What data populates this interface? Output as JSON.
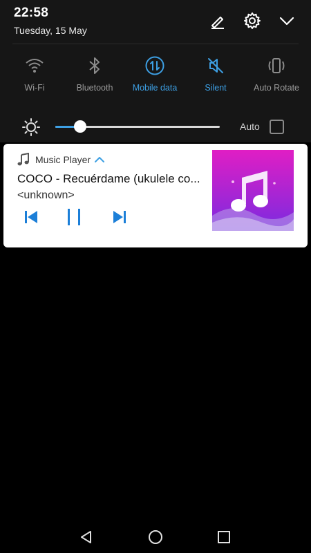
{
  "status": {
    "time": "22:58",
    "date": "Tuesday, 15 May"
  },
  "header_actions": {
    "edit_icon": "pencil-edit-icon",
    "settings_icon": "gear-icon",
    "collapse_icon": "chevron-down-icon"
  },
  "quick_toggles": [
    {
      "label": "Wi-Fi",
      "icon": "wifi-icon",
      "active": false
    },
    {
      "label": "Bluetooth",
      "icon": "bluetooth-icon",
      "active": false
    },
    {
      "label": "Mobile data",
      "icon": "mobile-data-icon",
      "active": true
    },
    {
      "label": "Silent",
      "icon": "silent-icon",
      "active": true
    },
    {
      "label": "Auto Rotate",
      "icon": "auto-rotate-icon",
      "active": false
    }
  ],
  "brightness": {
    "level": 0.15,
    "auto_label": "Auto",
    "auto_checked": false
  },
  "music": {
    "app_name": "Music Player",
    "title": "COCO - Recuérdame (ukulele co...",
    "artist": "<unknown>",
    "state": "playing"
  },
  "colors": {
    "accent": "#3d9fe3",
    "shade_bg": "#161616",
    "inactive_label": "#9a9a9a",
    "art_gradient_top": "#e01ec4",
    "art_gradient_bottom": "#7a2be0"
  }
}
